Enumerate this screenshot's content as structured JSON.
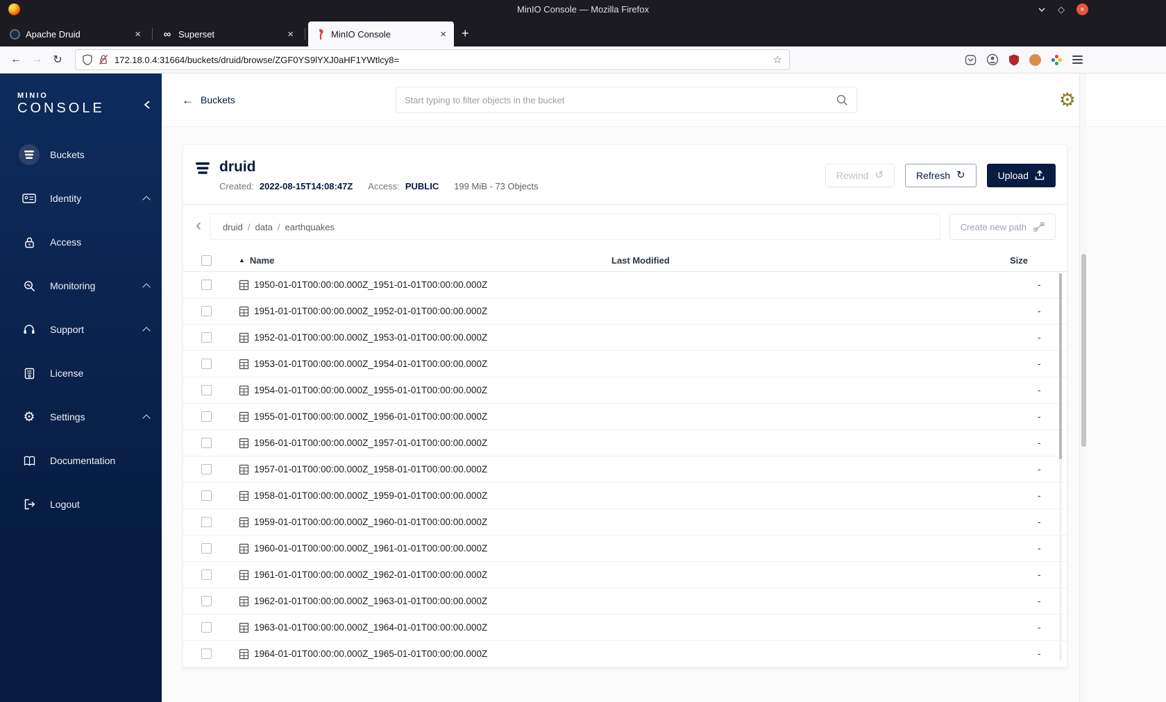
{
  "colors": {
    "sidebar_navy": "#081C42",
    "accent_navy": "#07193E",
    "upload_button_bg": "#081C42",
    "close_button_red": "#E9543F",
    "gear_gold": "#8A7A1E"
  },
  "window": {
    "title": "MinIO Console — Mozilla Firefox",
    "controls": {
      "minimize": "⌄",
      "maximize": "◇",
      "close": "×"
    },
    "tabs": [
      {
        "label": "Apache Druid",
        "close": "×"
      },
      {
        "label": "Superset",
        "close": "×"
      },
      {
        "label": "MinIO Console",
        "close": "×"
      }
    ],
    "new_tab": "+",
    "nav": {
      "back": "←",
      "forward": "→",
      "reload": "↻",
      "star": "☆",
      "url": "172.18.0.4:31664/buckets/druid/browse/ZGF0YS9lYXJ0aHF1YWtlcy8="
    }
  },
  "sidebar": {
    "logo_line1": "MINIO",
    "logo_line2": "CONSOLE",
    "items": [
      {
        "label": "Buckets",
        "active": true
      },
      {
        "label": "Identity",
        "expandable": true
      },
      {
        "label": "Access"
      },
      {
        "label": "Monitoring",
        "expandable": true
      },
      {
        "label": "Support",
        "expandable": true
      },
      {
        "label": "License"
      },
      {
        "label": "Settings",
        "expandable": true
      },
      {
        "label": "Documentation"
      }
    ],
    "logout_label": "Logout",
    "settings_gear_glyph": "⚙"
  },
  "topbar": {
    "back_label": "Buckets",
    "back_arrow": "←",
    "search_placeholder": "Start typing to filter objects in the bucket",
    "gear_glyph": "⚙"
  },
  "bucket": {
    "name": "druid",
    "created_label": "Created:",
    "created_value": "2022-08-15T14:08:47Z",
    "access_label": "Access:",
    "access_value": "PUBLIC",
    "summary": "199 MiB - 73 Objects",
    "buttons": {
      "rewind": "Rewind",
      "rewind_icon": "↺",
      "refresh": "Refresh",
      "refresh_icon": "↻",
      "upload": "Upload"
    }
  },
  "browser": {
    "back_chevron": "‹",
    "breadcrumb": [
      "druid",
      "data",
      "earthquakes"
    ],
    "separator": "/",
    "create_path_label": "Create new path",
    "table": {
      "sort_icon": "▲",
      "columns": {
        "name": "Name",
        "last_modified": "Last Modified",
        "size": "Size"
      },
      "rows": [
        {
          "name": "1950-01-01T00:00:00.000Z_1951-01-01T00:00:00.000Z",
          "last_modified": "",
          "size": "-"
        },
        {
          "name": "1951-01-01T00:00:00.000Z_1952-01-01T00:00:00.000Z",
          "last_modified": "",
          "size": "-"
        },
        {
          "name": "1952-01-01T00:00:00.000Z_1953-01-01T00:00:00.000Z",
          "last_modified": "",
          "size": "-"
        },
        {
          "name": "1953-01-01T00:00:00.000Z_1954-01-01T00:00:00.000Z",
          "last_modified": "",
          "size": "-"
        },
        {
          "name": "1954-01-01T00:00:00.000Z_1955-01-01T00:00:00.000Z",
          "last_modified": "",
          "size": "-"
        },
        {
          "name": "1955-01-01T00:00:00.000Z_1956-01-01T00:00:00.000Z",
          "last_modified": "",
          "size": "-"
        },
        {
          "name": "1956-01-01T00:00:00.000Z_1957-01-01T00:00:00.000Z",
          "last_modified": "",
          "size": "-"
        },
        {
          "name": "1957-01-01T00:00:00.000Z_1958-01-01T00:00:00.000Z",
          "last_modified": "",
          "size": "-"
        },
        {
          "name": "1958-01-01T00:00:00.000Z_1959-01-01T00:00:00.000Z",
          "last_modified": "",
          "size": "-"
        },
        {
          "name": "1959-01-01T00:00:00.000Z_1960-01-01T00:00:00.000Z",
          "last_modified": "",
          "size": "-"
        },
        {
          "name": "1960-01-01T00:00:00.000Z_1961-01-01T00:00:00.000Z",
          "last_modified": "",
          "size": "-"
        },
        {
          "name": "1961-01-01T00:00:00.000Z_1962-01-01T00:00:00.000Z",
          "last_modified": "",
          "size": "-"
        },
        {
          "name": "1962-01-01T00:00:00.000Z_1963-01-01T00:00:00.000Z",
          "last_modified": "",
          "size": "-"
        },
        {
          "name": "1963-01-01T00:00:00.000Z_1964-01-01T00:00:00.000Z",
          "last_modified": "",
          "size": "-"
        },
        {
          "name": "1964-01-01T00:00:00.000Z_1965-01-01T00:00:00.000Z",
          "last_modified": "",
          "size": "-"
        }
      ]
    }
  }
}
